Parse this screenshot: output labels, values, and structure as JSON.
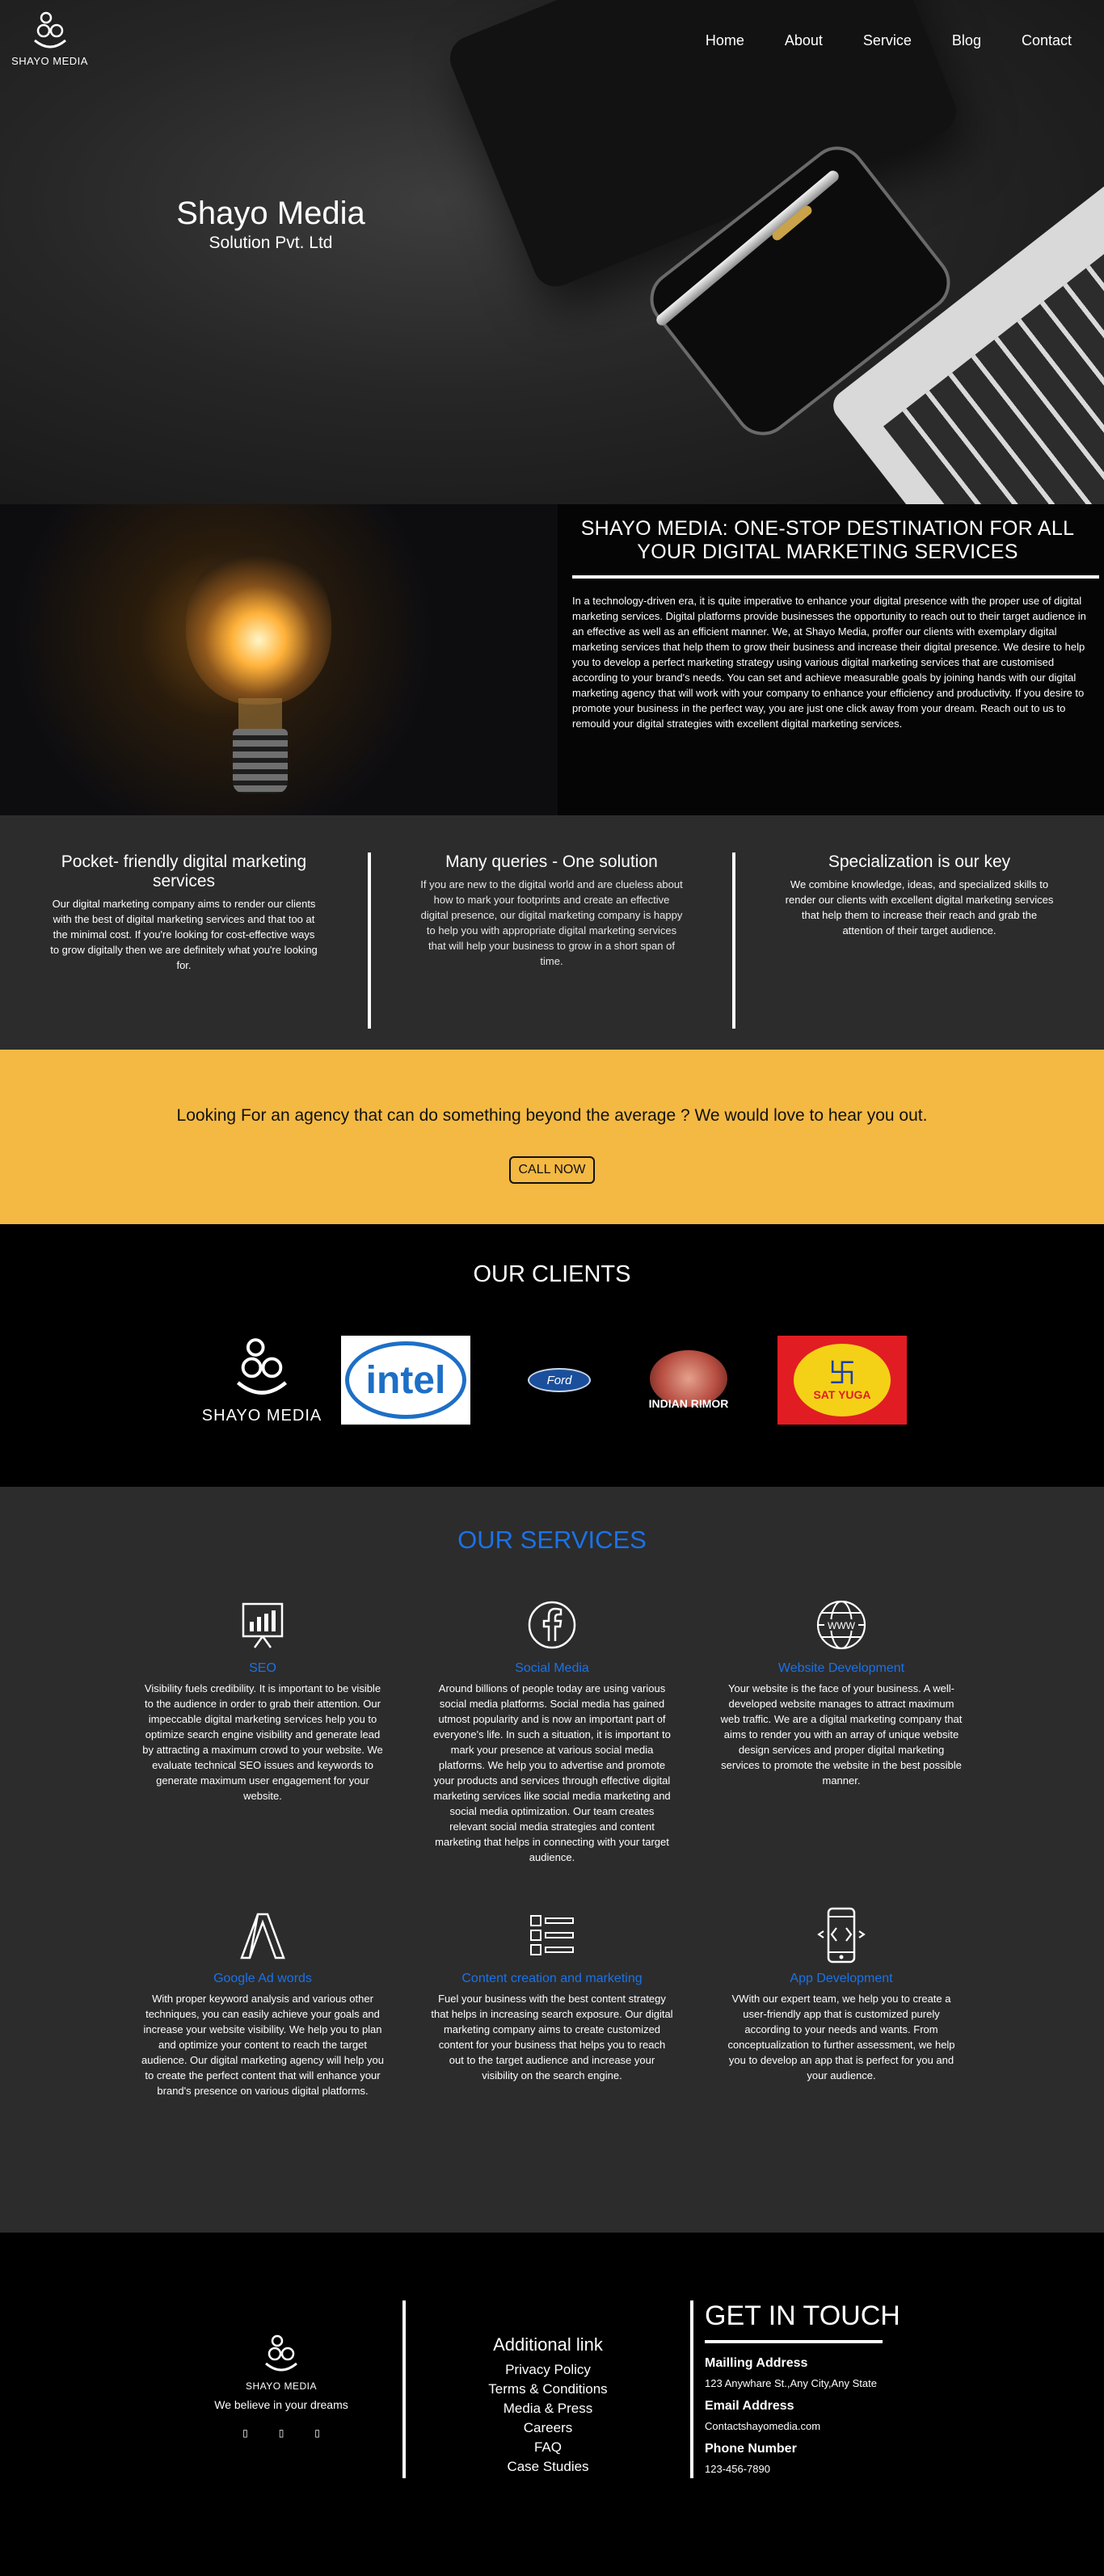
{
  "brand": {
    "name": "SHAYO MEDIA"
  },
  "nav": {
    "items": [
      "Home",
      "About",
      "Service",
      "Blog",
      "Contact"
    ]
  },
  "hero": {
    "title": "Shayo Media",
    "subtitle": "Solution Pvt. Ltd"
  },
  "about": {
    "heading": "SHAYO MEDIA: ONE-STOP DESTINATION FOR ALL YOUR DIGITAL MARKETING SERVICES",
    "body": "In a technology-driven era, it is quite imperative to enhance your digital presence with the proper use of digital marketing services. Digital platforms provide businesses the opportunity to reach out to their target audience in an effective as well as an efficient manner. We, at Shayo Media, proffer our clients with exemplary digital marketing services that help them to grow their business and increase their digital presence. We desire to help you to develop a perfect marketing strategy using various digital marketing services that are customised according to your brand's needs. You can set and achieve measurable goals by joining hands with our digital marketing agency that will work with your company to enhance your efficiency and productivity. If you desire to promote your business in the perfect way, you are just one click away from your dream. Reach out to us to remould your digital strategies with excellent digital marketing services."
  },
  "features": [
    {
      "title": "Pocket- friendly digital marketing services",
      "body": "Our digital marketing company aims to render our clients with the best of digital marketing services and that too at the minimal cost. If you're looking for cost-effective ways to grow digitally then we are definitely what you're looking for."
    },
    {
      "title": "Many queries - One solution",
      "body": "If you are new to the digital world and are clueless about how to mark your footprints and create an effective digital presence, our digital marketing company is happy to help you with appropriate digital marketing services that will help your business to grow in a short span of time."
    },
    {
      "title": "Specialization is our key",
      "body": "We combine knowledge, ideas, and specialized skills to render our clients with excellent digital marketing services that help them to increase their reach and grab the attention of their target audience."
    }
  ],
  "cta": {
    "text": "Looking For an agency that can do something beyond the average ? We would love to hear you out.",
    "button": "CALL NOW"
  },
  "clients": {
    "heading": "OUR CLIENTS",
    "intel": "intel",
    "ford": "Ford",
    "rimor": "INDIAN RIMOR",
    "satyuga": "SAT YUGA"
  },
  "services": {
    "heading": "OUR SERVICES",
    "items": [
      {
        "icon": "presentation-board-icon",
        "title": "SEO",
        "body": "Visibility fuels credibility. It is important to be visible to the audience in order to grab their attention. Our impeccable digital marketing services help you to optimize search engine visibility and generate lead by attracting a maximum crowd to your website. We evaluate technical SEO issues and keywords to generate maximum user engagement for your website."
      },
      {
        "icon": "facebook-icon",
        "title": "Social Media",
        "body": "Around billions of people today are using various social media platforms. Social media has gained utmost popularity and is now an important part of everyone's life. In such a situation, it is important to mark your presence at various social media platforms. We help you to advertise and promote your products and services through effective digital marketing services like social media marketing and social media optimization. Our team creates relevant social media strategies and content marketing that helps in connecting with your target audience."
      },
      {
        "icon": "www-globe-icon",
        "title": "Website Development",
        "body": "Your website is the face of your business. A well-developed website manages to attract maximum web traffic. We are a digital marketing company that aims to render you with an array of unique website design services and proper digital marketing services to promote the website in the best possible manner."
      },
      {
        "icon": "google-ads-icon",
        "title": "Google Ad words",
        "body": "With proper keyword analysis and various other techniques, you can easily achieve your goals and increase your website visibility. We help you to plan and optimize your content to reach the target audience. Our digital marketing agency will help you to create the perfect content that will enhance your brand's presence on various digital platforms."
      },
      {
        "icon": "checklist-icon",
        "title": "Content creation and marketing",
        "body": "Fuel your business with the best content strategy that helps in increasing search exposure. Our digital marketing company aims to create customized content for your business that helps you to reach out to the target audience and increase your visibility on the search engine."
      },
      {
        "icon": "mobile-app-icon",
        "title": "App Development",
        "body": "VWith our expert team, we help you to create a user-friendly app that is customized purely according to your needs and wants. From conceptualization to further assessment, we help you to develop an app that is perfect for you and your audience."
      }
    ]
  },
  "footer": {
    "brand": "SHAYO MEDIA",
    "tagline": "We believe in your dreams",
    "links_heading": "Additional link",
    "links": [
      "Privacy Policy",
      "Terms & Conditions",
      "Media & Press",
      "Careers",
      "FAQ",
      "Case Studies"
    ],
    "contact_heading": "GET IN TOUCH",
    "mail_label": "Mailling Address",
    "mail_value": "123 Anywhare St.,Any City,Any State",
    "email_label": "Email Address",
    "email_value": "Contactshayomedia.com",
    "phone_label": "Phone Number",
    "phone_value": "123-456-7890"
  }
}
